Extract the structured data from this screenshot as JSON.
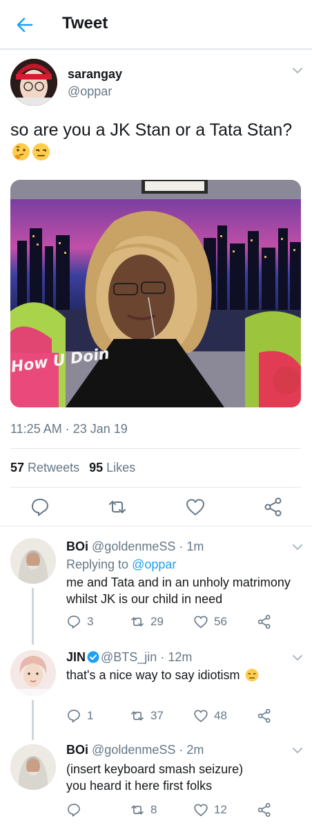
{
  "header": {
    "title": "Tweet",
    "back_icon": "back-arrow-icon"
  },
  "tweet": {
    "author_name": "sarangay",
    "author_handle": "@oppar",
    "text": "so are you a JK Stan or a Tata Stan?",
    "emojis": [
      "thinking-face-emoji",
      "unamused-face-emoji"
    ],
    "media_caption": "How U Doin",
    "timestamp": "11:25 AM · 23 Jan 19",
    "retweets_count": "57",
    "retweets_label": "Retweets",
    "likes_count": "95",
    "likes_label": "Likes"
  },
  "replies": [
    {
      "name": "BOi",
      "handle": "@goldenmeSS",
      "time": "· 1m",
      "replying_label": "Replying to",
      "replying_handle": "@oppar",
      "text_line1": "me and Tata and in an unholy matrimony",
      "text_line2": "whilst JK is our child in need",
      "reply_count": "3",
      "retweet_count": "29",
      "like_count": "56"
    },
    {
      "name": "JIN",
      "handle": "@BTS_jin",
      "time": "· 12m",
      "verified": true,
      "text_line1": "that's a nice way to say idiotism",
      "reply_count": "1",
      "retweet_count": "37",
      "like_count": "48"
    },
    {
      "name": "BOi",
      "handle": "@goldenmeSS",
      "time": "· 2m",
      "text_line1": "(insert keyboard smash seizure)",
      "text_line2": "you heard it here first folks",
      "reply_count": "",
      "retweet_count": "8",
      "like_count": "12"
    }
  ],
  "colors": {
    "accent": "#1da1f2",
    "secondary_text": "#657786",
    "primary_text": "#14171a",
    "divider": "#e1e8ed"
  }
}
